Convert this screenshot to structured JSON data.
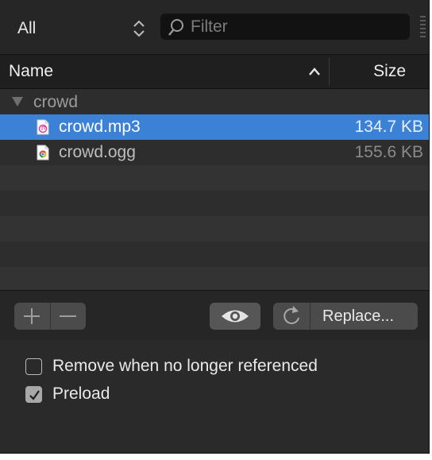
{
  "top_bar": {
    "kind_filter": {
      "selected": "All",
      "icon": "up-down-chevron-icon"
    },
    "filter": {
      "placeholder": "Filter",
      "value": "",
      "icon": "search-icon"
    }
  },
  "columns": {
    "name": "Name",
    "size": "Size",
    "sort": "ascending"
  },
  "tree": {
    "group": {
      "label": "crowd",
      "expanded": true
    },
    "files": [
      {
        "name": "crowd.mp3",
        "size": "134.7 KB",
        "icon": "audio-file-icon",
        "selected": true
      },
      {
        "name": "crowd.ogg",
        "size": "155.6 KB",
        "icon": "chrome-file-icon",
        "selected": false
      }
    ]
  },
  "toolbar": {
    "add_icon": "plus-icon",
    "remove_icon": "minus-icon",
    "preview_icon": "eye-icon",
    "reload_icon": "reload-icon",
    "replace_label": "Replace..."
  },
  "options": [
    {
      "label": "Remove when no longer referenced",
      "checked": false
    },
    {
      "label": "Preload",
      "checked": true
    }
  ],
  "colors": {
    "selection": "#3b82d6",
    "panel": "#2a2a2a"
  }
}
